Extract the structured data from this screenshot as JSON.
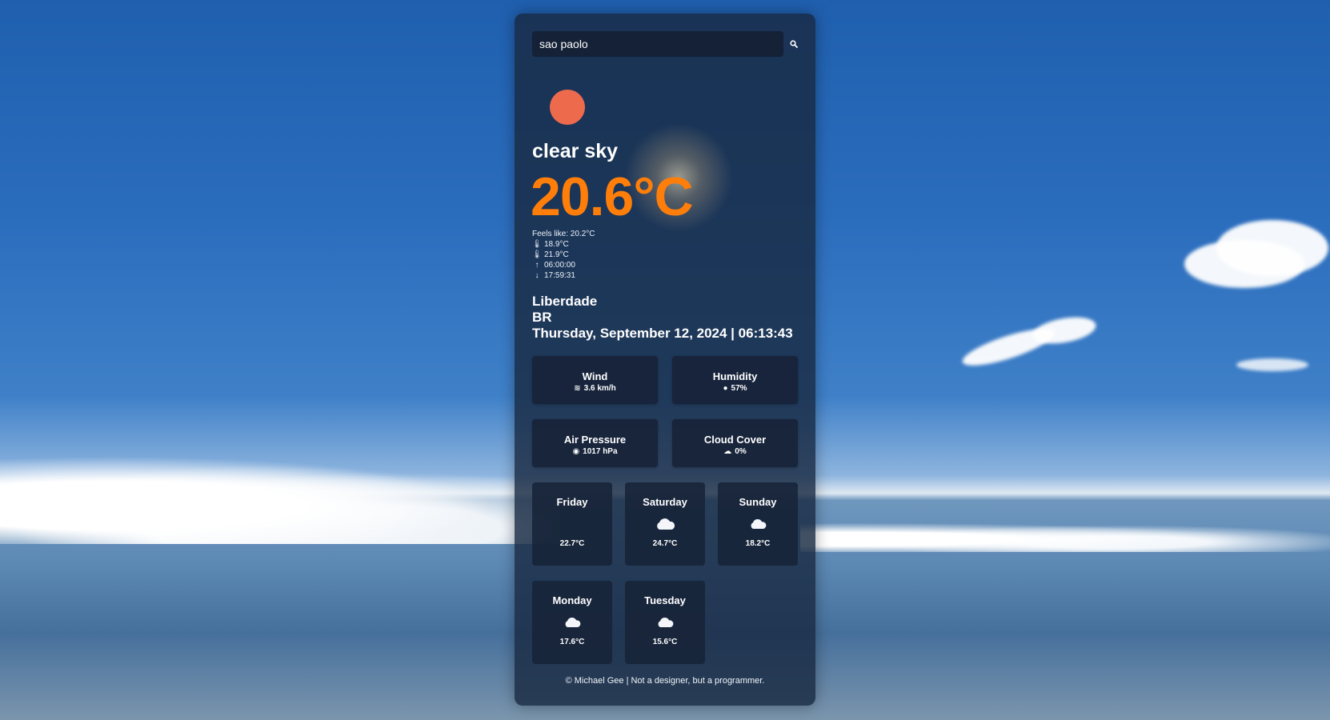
{
  "search": {
    "value": "sao paolo"
  },
  "weather": {
    "description": "clear sky",
    "temperature": "20.6°C",
    "feels_like": "Feels like: 20.2°C",
    "temp_min": "18.9°C",
    "temp_max": "21.9°C",
    "sunrise": "06:00:00",
    "sunset": "17:59:31"
  },
  "location": {
    "city": "Liberdade",
    "country": "BR",
    "datetime": "Thursday, September 12, 2024 | 06:13:43"
  },
  "stats": {
    "wind": {
      "title": "Wind",
      "value": "3.6 km/h"
    },
    "humidity": {
      "title": "Humidity",
      "value": "57%"
    },
    "pressure": {
      "title": "Air Pressure",
      "value": "1017 hPa"
    },
    "clouds": {
      "title": "Cloud Cover",
      "value": "0%"
    }
  },
  "forecast": [
    {
      "day": "Friday",
      "temp": "22.7°C",
      "icon": "none"
    },
    {
      "day": "Saturday",
      "temp": "24.7°C",
      "icon": "cloud-icon"
    },
    {
      "day": "Sunday",
      "temp": "18.2°C",
      "icon": "cloud-icon"
    },
    {
      "day": "Monday",
      "temp": "17.6°C",
      "icon": "cloud-icon"
    },
    {
      "day": "Tuesday",
      "temp": "15.6°C",
      "icon": "cloud-icon"
    }
  ],
  "footer": "© Michael Gee | Not a designer, but a programmer.",
  "colors": {
    "accent_temp": "#ff7e0a",
    "sun": "#ee6a4d",
    "card": "#192942"
  }
}
